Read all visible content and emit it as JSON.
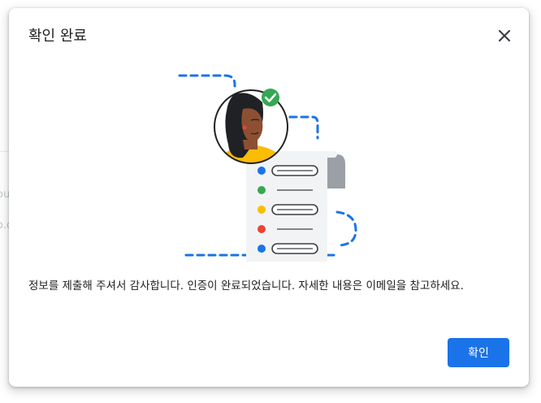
{
  "background": {
    "fragment_1": "ou",
    "fragment_2": "o.c"
  },
  "dialog": {
    "title": "확인 완료",
    "close_icon": "close-icon",
    "message": "정보를 제출해 주셔서 감사합니다. 인증이 완료되었습니다. 자세한 내용은 이메일을 참고하세요.",
    "confirm_label": "확인"
  },
  "illustration": {
    "icons": [
      "avatar",
      "check-badge-icon",
      "document-list"
    ],
    "list_bullet_colors": [
      "#1a73e8",
      "#34a853",
      "#fbbc04",
      "#ea4335",
      "#1a73e8"
    ],
    "accent": "#1a73e8",
    "check_color": "#34a853"
  },
  "colors": {
    "primary": "#1a73e8",
    "text": "#202124"
  }
}
